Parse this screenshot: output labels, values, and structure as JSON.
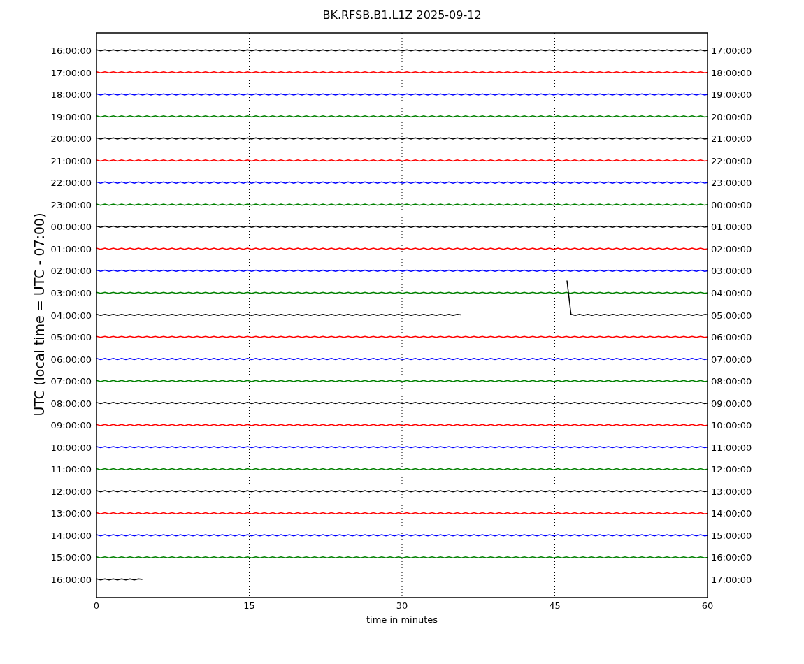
{
  "title": "BK.RFSB.B1.L1Z 2025-09-12",
  "ylabel": "UTC (local time = UTC - 07:00)",
  "xlabel": "time in minutes",
  "xticks": [
    "0",
    "15",
    "30",
    "45",
    "60"
  ],
  "rows": [
    {
      "left": "16:00:00",
      "right": "17:00:00",
      "color": "#000000",
      "kind": "full"
    },
    {
      "left": "17:00:00",
      "right": "18:00:00",
      "color": "#ff0000",
      "kind": "full"
    },
    {
      "left": "18:00:00",
      "right": "19:00:00",
      "color": "#0000ff",
      "kind": "full"
    },
    {
      "left": "19:00:00",
      "right": "20:00:00",
      "color": "#008000",
      "kind": "full"
    },
    {
      "left": "20:00:00",
      "right": "21:00:00",
      "color": "#000000",
      "kind": "full"
    },
    {
      "left": "21:00:00",
      "right": "22:00:00",
      "color": "#ff0000",
      "kind": "full"
    },
    {
      "left": "22:00:00",
      "right": "23:00:00",
      "color": "#0000ff",
      "kind": "full"
    },
    {
      "left": "23:00:00",
      "right": "00:00:00",
      "color": "#008000",
      "kind": "full"
    },
    {
      "left": "00:00:00",
      "right": "01:00:00",
      "color": "#000000",
      "kind": "full"
    },
    {
      "left": "01:00:00",
      "right": "02:00:00",
      "color": "#ff0000",
      "kind": "full"
    },
    {
      "left": "02:00:00",
      "right": "03:00:00",
      "color": "#0000ff",
      "kind": "full"
    },
    {
      "left": "03:00:00",
      "right": "04:00:00",
      "color": "#008000",
      "kind": "full"
    },
    {
      "left": "04:00:00",
      "right": "05:00:00",
      "color": "#000000",
      "kind": "gap"
    },
    {
      "left": "05:00:00",
      "right": "06:00:00",
      "color": "#ff0000",
      "kind": "full"
    },
    {
      "left": "06:00:00",
      "right": "07:00:00",
      "color": "#0000ff",
      "kind": "full"
    },
    {
      "left": "07:00:00",
      "right": "08:00:00",
      "color": "#008000",
      "kind": "full"
    },
    {
      "left": "08:00:00",
      "right": "09:00:00",
      "color": "#000000",
      "kind": "full"
    },
    {
      "left": "09:00:00",
      "right": "10:00:00",
      "color": "#ff0000",
      "kind": "full"
    },
    {
      "left": "10:00:00",
      "right": "11:00:00",
      "color": "#0000ff",
      "kind": "full"
    },
    {
      "left": "11:00:00",
      "right": "12:00:00",
      "color": "#008000",
      "kind": "full"
    },
    {
      "left": "12:00:00",
      "right": "13:00:00",
      "color": "#000000",
      "kind": "full"
    },
    {
      "left": "13:00:00",
      "right": "14:00:00",
      "color": "#ff0000",
      "kind": "full"
    },
    {
      "left": "14:00:00",
      "right": "15:00:00",
      "color": "#0000ff",
      "kind": "full"
    },
    {
      "left": "15:00:00",
      "right": "16:00:00",
      "color": "#008000",
      "kind": "full"
    },
    {
      "left": "16:00:00",
      "right": "17:00:00",
      "color": "#000000",
      "kind": "partial"
    }
  ]
}
